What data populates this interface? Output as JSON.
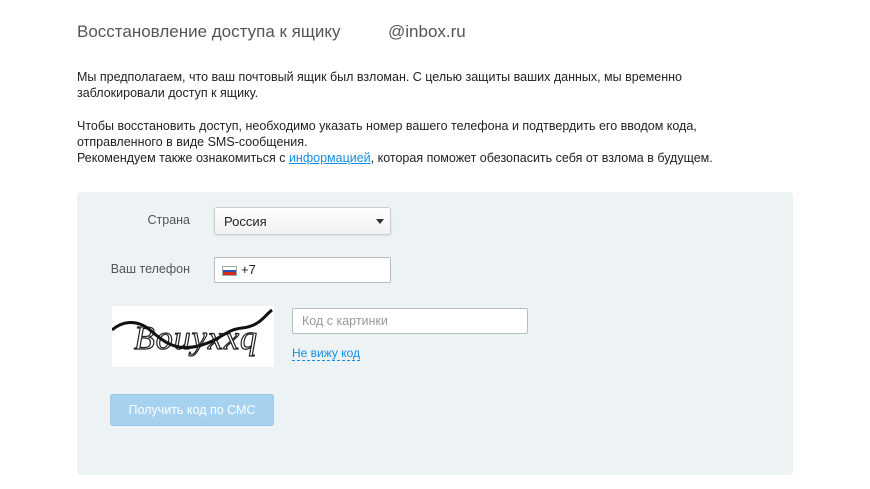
{
  "header": {
    "title": "Восстановление доступа к ящику",
    "email_domain": "@inbox.ru"
  },
  "intro": {
    "paragraph1": "Мы предполагаем, что ваш почтовый ящик был взломан. С целью защиты ваших данных, мы временно заблокировали доступ к ящику.",
    "paragraph2_line1": "Чтобы восстановить доступ, необходимо указать номер вашего телефона и подтвердить его вводом кода, отправленного в виде SMS-сообщения.",
    "paragraph2_before_link": "Рекомендуем также ознакомиться с ",
    "link_text": "информацией",
    "paragraph2_after_link": ", которая поможет обезопасить себя от взлома в будущем."
  },
  "form": {
    "country_label": "Страна",
    "country_value": "Россия",
    "phone_label": "Ваш телефон",
    "phone_prefix": "+7",
    "flag_icon": "russia-flag-icon",
    "captcha_text": "Bouyxxq",
    "captcha_placeholder": "Код с картинки",
    "no_code_link": "Не вижу код",
    "submit_label": "Получить код по СМС"
  },
  "colors": {
    "panel_bg": "#edf2f5",
    "link": "#168de2",
    "button_disabled": "#a6d1ef"
  }
}
